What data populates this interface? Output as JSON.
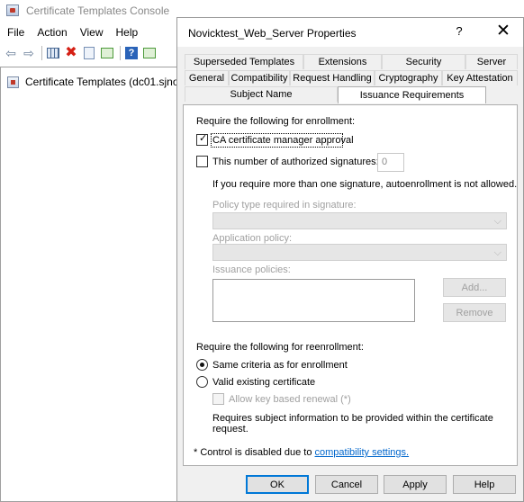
{
  "console": {
    "title": "Certificate Templates Console",
    "menu": [
      "File",
      "Action",
      "View",
      "Help"
    ],
    "toolbar_icons": [
      "back-arrow-icon",
      "forward-arrow-icon",
      "show-hide-tree-icon",
      "delete-icon",
      "properties-icon",
      "export-list-icon",
      "help-icon",
      "action-pane-icon"
    ],
    "tree_item": "Certificate Templates (dc01.sjno"
  },
  "dialog": {
    "title": "Novicktest_Web_Server Properties",
    "help_glyph": "?",
    "close_glyph": "✕",
    "tabs_row1": [
      "Superseded Templates",
      "Extensions",
      "Security",
      "Server"
    ],
    "tabs_row2": [
      "General",
      "Compatibility",
      "Request Handling",
      "Cryptography",
      "Key Attestation"
    ],
    "tabs_row3": [
      "Subject Name",
      "Issuance Requirements"
    ],
    "active_tab": "Issuance Requirements",
    "enrollment": {
      "heading": "Require the following for enrollment:",
      "ca_approval": "CA certificate manager approval",
      "ca_approval_checked": true,
      "signatures": "This number of authorized signatures:",
      "signatures_checked": false,
      "signatures_value": "0",
      "note": "If you require more than one signature, autoenrollment is not allowed.",
      "policy_type_label": "Policy type required in signature:",
      "application_policy_label": "Application policy:",
      "issuance_policies_label": "Issuance policies:",
      "add_button": "Add...",
      "remove_button": "Remove"
    },
    "reenrollment": {
      "heading": "Require the following for reenrollment:",
      "same_criteria": "Same criteria as for enrollment",
      "valid_existing": "Valid existing certificate",
      "selected": "same_criteria",
      "allow_key_renewal": "Allow key based renewal (*)",
      "subject_info_note": "Requires subject information to be provided within the certificate request."
    },
    "footer": {
      "prefix": "* Control is disabled due to ",
      "link": "compatibility settings."
    },
    "buttons": {
      "ok": "OK",
      "cancel": "Cancel",
      "apply": "Apply",
      "help": "Help"
    }
  }
}
